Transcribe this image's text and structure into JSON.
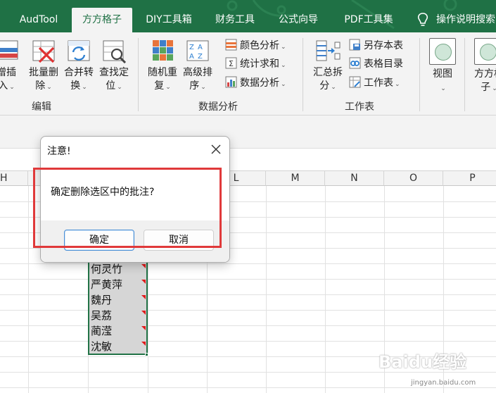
{
  "ribbon_tabs": [
    "AudTool",
    "方方格子",
    "DIY工具箱",
    "财务工具",
    "公式向导",
    "PDF工具集",
    "操作说明搜索"
  ],
  "active_tab": "方方格子",
  "ribbon": {
    "edit": {
      "insert_btn_top": "增插",
      "insert_btn_bottom": "入",
      "batch_delete_top": "批量删",
      "batch_delete_bottom": "除",
      "merge_top": "合并转",
      "merge_bottom": "换",
      "find_top": "查找定",
      "find_bottom": "位",
      "group_label": "编辑"
    },
    "analysis": {
      "random_top": "随机重",
      "random_bottom": "复",
      "sort_top": "高级排",
      "sort_bottom": "序",
      "color_analysis": "颜色分析",
      "stat_sum": "统计求和",
      "data_analysis": "数据分析",
      "group_label": "数据分析"
    },
    "sheet": {
      "summary_top": "汇总拆",
      "summary_bottom": "分",
      "save_sheet": "另存本表",
      "sheet_dir": "表格目录",
      "worksheet": "工作表",
      "group_label": "工作表"
    },
    "view": {
      "view_label": "视图",
      "ffgz_top": "方方格",
      "ffgz_bottom": "子"
    }
  },
  "columns": [
    "H",
    "L",
    "M",
    "N",
    "O",
    "P"
  ],
  "cells": [
    "何灵竹",
    "严黄萍",
    "魏丹",
    "吴荔",
    "蔺滢",
    "沈敏"
  ],
  "dialog": {
    "title": "注意!",
    "message": "确定删除选区中的批注?",
    "ok": "确定",
    "cancel": "取消"
  },
  "watermark": {
    "main": "Baidu经验",
    "sub": "jingyan.baidu.com"
  },
  "colors": {
    "excel_green": "#1f7145",
    "highlight_red": "#e0393a",
    "comment_marker": "#e01b1b"
  }
}
